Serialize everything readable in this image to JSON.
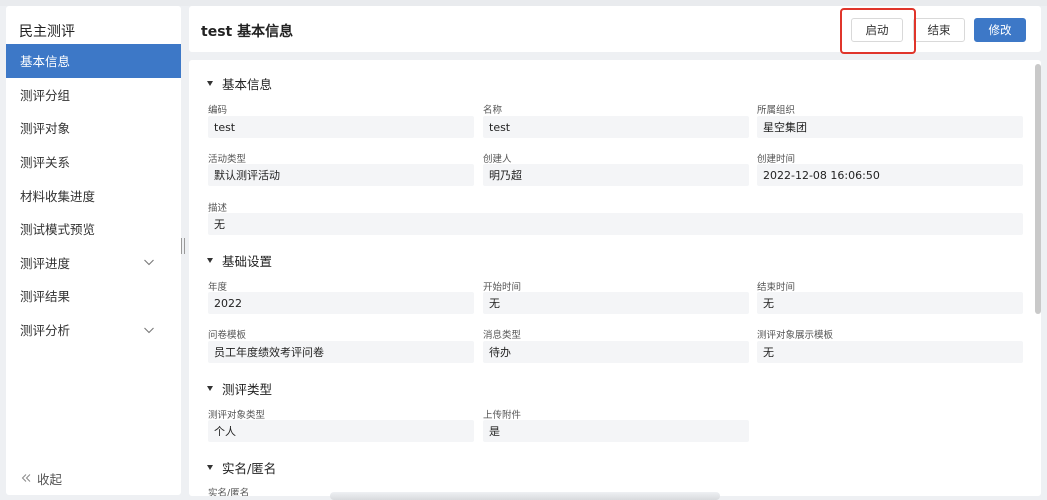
{
  "sidebar": {
    "title": "民主测评",
    "items": [
      {
        "label": "基本信息",
        "active": true
      },
      {
        "label": "测评分组"
      },
      {
        "label": "测评对象"
      },
      {
        "label": "测评关系"
      },
      {
        "label": "材料收集进度"
      },
      {
        "label": "测试模式预览"
      },
      {
        "label": "测评进度",
        "expandable": true
      },
      {
        "label": "测评结果"
      },
      {
        "label": "测评分析",
        "expandable": true
      }
    ],
    "collapse_label": "收起"
  },
  "header": {
    "title": "test  基本信息",
    "start_label": "启动",
    "end_label": "结束",
    "edit_label": "修改"
  },
  "sections": {
    "basic": {
      "title": "基本信息",
      "code_label": "编码",
      "code_value": "test",
      "name_label": "名称",
      "name_value": "test",
      "org_label": "所属组织",
      "org_value": "星空集团",
      "type_label": "活动类型",
      "type_value": "默认测评活动",
      "creator_label": "创建人",
      "creator_value": "明乃超",
      "created_label": "创建时间",
      "created_value": "2022-12-08 16:06:50",
      "desc_label": "描述",
      "desc_value": "无"
    },
    "settings": {
      "title": "基础设置",
      "year_label": "年度",
      "year_value": "2022",
      "start_label": "开始时间",
      "start_value": "无",
      "end_label": "结束时间",
      "end_value": "无",
      "template_label": "问卷模板",
      "template_value": "员工年度绩效考评问卷",
      "msg_label": "消息类型",
      "msg_value": "待办",
      "display_label": "测评对象展示模板",
      "display_value": "无"
    },
    "type": {
      "title": "测评类型",
      "target_label": "测评对象类型",
      "target_value": "个人",
      "upload_label": "上传附件",
      "upload_value": "是"
    },
    "anon": {
      "title": "实名/匿名",
      "label": "实名/匿名"
    }
  },
  "colors": {
    "accent": "#3d78c7",
    "highlight": "#e0352b"
  }
}
